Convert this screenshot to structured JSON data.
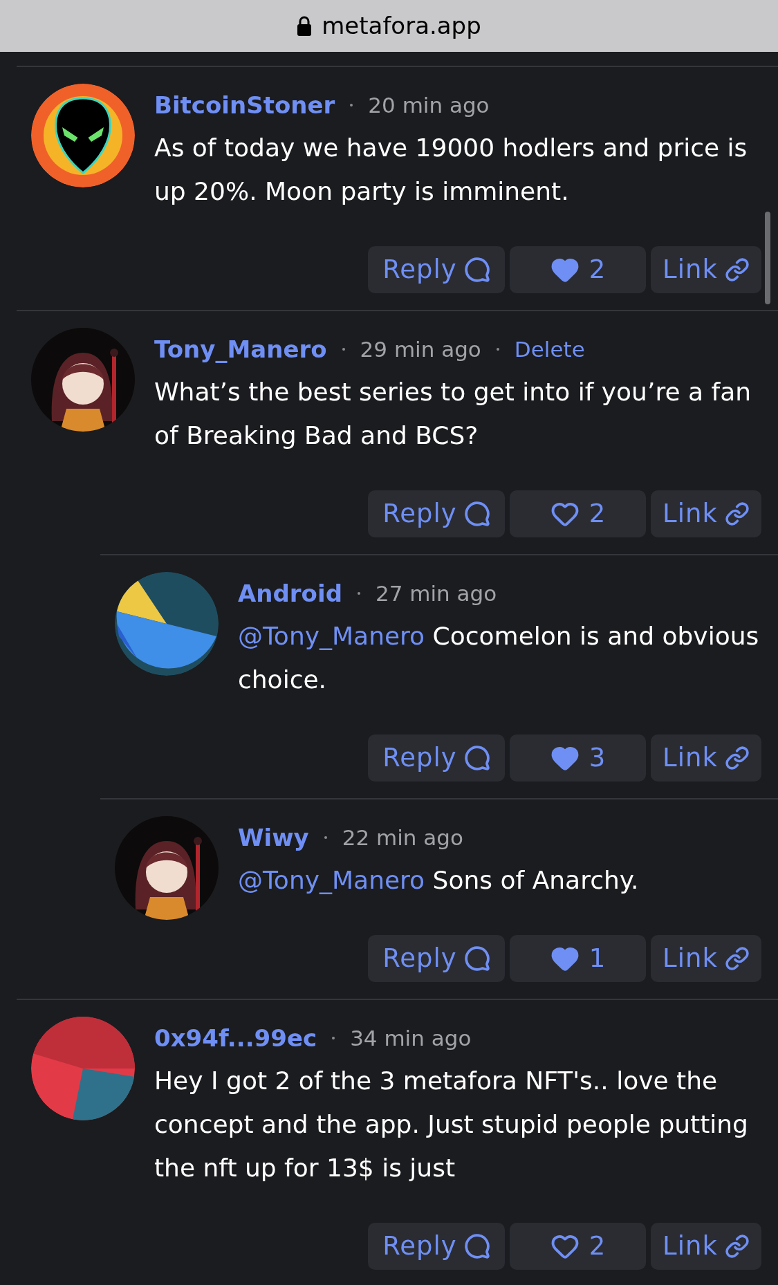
{
  "address_bar": {
    "url": "metafora.app"
  },
  "comments": [
    {
      "user": "BitcoinStoner",
      "time": "20 min ago",
      "avatar": {
        "kind": "alien"
      },
      "body": {
        "text": "As of today we have 19000 hodlers and price is up 20%. Moon party is imminent."
      },
      "reply_label": "Reply",
      "likes": "2",
      "liked": true,
      "link_label": "Link"
    },
    {
      "user": "Tony_Manero",
      "time": "29 min ago",
      "delete_label": "Delete",
      "avatar": {
        "kind": "picture"
      },
      "body": {
        "text": "What’s the best series to get into if you’re a fan of Breaking Bad and BCS?"
      },
      "reply_label": "Reply",
      "likes": "2",
      "liked": false,
      "link_label": "Link",
      "children": [
        {
          "user": "Android",
          "time": "27 min ago",
          "avatar": {
            "kind": "tricolor"
          },
          "body": {
            "mention": "@Tony_Manero",
            "text": "Cocomelon is and obvious choice."
          },
          "reply_label": "Reply",
          "likes": "3",
          "liked": true,
          "link_label": "Link"
        },
        {
          "user": "Wiwy",
          "time": "22 min ago",
          "avatar": {
            "kind": "picture"
          },
          "body": {
            "mention": "@Tony_Manero",
            "text": "Sons of Anarchy."
          },
          "reply_label": "Reply",
          "likes": "1",
          "liked": true,
          "link_label": "Link"
        }
      ]
    },
    {
      "user": "0x94f...99ec",
      "time": "34 min ago",
      "avatar": {
        "kind": "bicolor"
      },
      "body": {
        "text": "Hey I got 2 of the 3 metafora NFT's.. love the concept and the app. Just stupid people putting the nft up for 13$ is just"
      },
      "reply_label": "Reply",
      "likes": "2",
      "liked": false,
      "link_label": "Link"
    }
  ]
}
